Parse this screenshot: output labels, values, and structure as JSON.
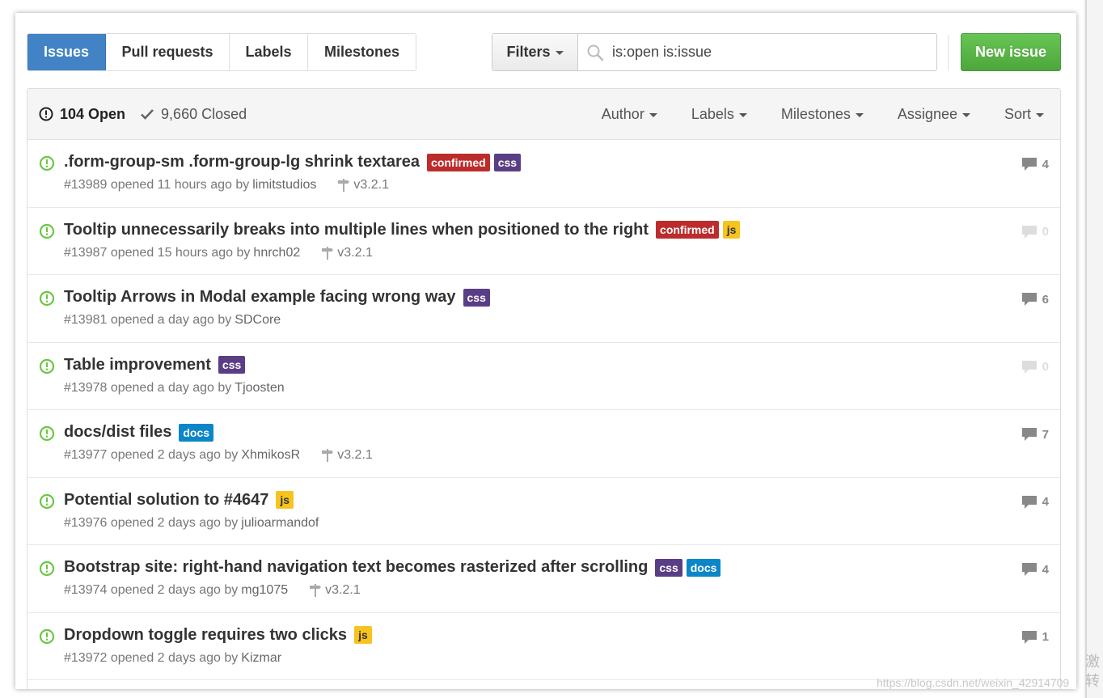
{
  "colors": {
    "accent_blue": "#4183c4",
    "new_issue_green": "#55b544",
    "open_icon_green": "#6cc644",
    "label_confirmed": "#bd2c2c",
    "label_css": "#5a3e85",
    "label_js": "#f7c41f",
    "label_docs": "#0b86c8"
  },
  "nav": {
    "tabs": [
      {
        "label": "Issues",
        "active": true
      },
      {
        "label": "Pull requests",
        "active": false
      },
      {
        "label": "Labels",
        "active": false
      },
      {
        "label": "Milestones",
        "active": false
      }
    ]
  },
  "filters": {
    "button_label": "Filters",
    "search_value": "is:open is:issue"
  },
  "new_issue_label": "New issue",
  "list_header": {
    "open_label": "104 Open",
    "closed_label": "9,660 Closed",
    "filters": [
      "Author",
      "Labels",
      "Milestones",
      "Assignee",
      "Sort"
    ]
  },
  "issues": [
    {
      "title": ".form-group-sm .form-group-lg shrink textarea",
      "labels": [
        {
          "name": "confirmed",
          "color": "#bd2c2c"
        },
        {
          "name": "css",
          "color": "#5a3e85"
        }
      ],
      "meta": "#13989 opened 11 hours ago by",
      "author": "limitstudios",
      "milestone": "v3.2.1",
      "comments": "4"
    },
    {
      "title": "Tooltip unnecessarily breaks into multiple lines when positioned to the right",
      "labels": [
        {
          "name": "confirmed",
          "color": "#bd2c2c"
        },
        {
          "name": "js",
          "color": "#f7c41f"
        }
      ],
      "meta": "#13987 opened 15 hours ago by",
      "author": "hnrch02",
      "milestone": "v3.2.1",
      "comments": "0"
    },
    {
      "title": "Tooltip Arrows in Modal example facing wrong way",
      "labels": [
        {
          "name": "css",
          "color": "#5a3e85"
        }
      ],
      "meta": "#13981 opened a day ago by",
      "author": "SDCore",
      "milestone": "",
      "comments": "6"
    },
    {
      "title": "Table improvement",
      "labels": [
        {
          "name": "css",
          "color": "#5a3e85"
        }
      ],
      "meta": "#13978 opened a day ago by",
      "author": "Tjoosten",
      "milestone": "",
      "comments": "0"
    },
    {
      "title": "docs/dist files",
      "labels": [
        {
          "name": "docs",
          "color": "#0b86c8"
        }
      ],
      "meta": "#13977 opened 2 days ago by",
      "author": "XhmikosR",
      "milestone": "v3.2.1",
      "comments": "7"
    },
    {
      "title": "Potential solution to #4647",
      "labels": [
        {
          "name": "js",
          "color": "#f7c41f"
        }
      ],
      "meta": "#13976 opened 2 days ago by",
      "author": "julioarmandof",
      "milestone": "",
      "comments": "4"
    },
    {
      "title": "Bootstrap site: right-hand navigation text becomes rasterized after scrolling",
      "labels": [
        {
          "name": "css",
          "color": "#5a3e85"
        },
        {
          "name": "docs",
          "color": "#0b86c8"
        }
      ],
      "meta": "#13974 opened 2 days ago by",
      "author": "mg1075",
      "milestone": "v3.2.1",
      "comments": "4"
    },
    {
      "title": "Dropdown toggle requires two clicks",
      "labels": [
        {
          "name": "js",
          "color": "#f7c41f"
        }
      ],
      "meta": "#13972 opened 2 days ago by",
      "author": "Kizmar",
      "milestone": "",
      "comments": "1"
    }
  ],
  "watermark": "https://blog.csdn.net/weixin_42914709",
  "watermark_chars": "激转"
}
